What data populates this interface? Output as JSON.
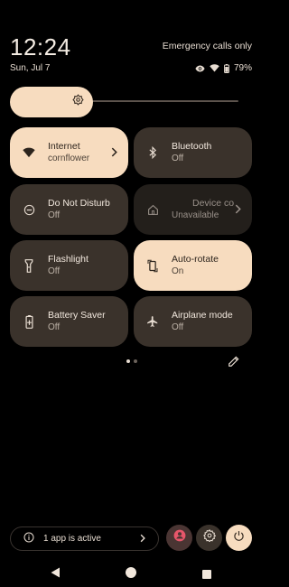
{
  "status": {
    "time": "12:24",
    "date": "Sun, Jul 7",
    "carrier": "Emergency calls only",
    "battery": "79%",
    "icons": [
      "eye-icon",
      "wifi-icon",
      "battery-icon"
    ]
  },
  "brightness": {
    "level": 0.3,
    "icon": "brightness-icon"
  },
  "tiles": [
    {
      "label": "Internet",
      "sub": "cornflower",
      "active": true,
      "icon": "wifi-icon"
    },
    {
      "label": "Bluetooth",
      "sub": "Off",
      "active": false,
      "icon": "bluetooth-icon"
    },
    {
      "label": "Do Not Disturb",
      "sub": "Off",
      "active": false,
      "icon": "dnd-icon"
    },
    {
      "label": "Device co",
      "sub": "Unavailable",
      "active": false,
      "icon": "home-icon"
    },
    {
      "label": "Flashlight",
      "sub": "Off",
      "active": false,
      "icon": "flashlight-icon"
    },
    {
      "label": "Auto-rotate",
      "sub": "On",
      "active": true,
      "icon": "rotate-icon"
    },
    {
      "label": "Battery Saver",
      "sub": "Off",
      "active": false,
      "icon": "battery-saver-icon"
    },
    {
      "label": "Airplane mode",
      "sub": "Off",
      "active": false,
      "icon": "airplane-icon"
    }
  ],
  "footer": {
    "active_apps": "1 app is active"
  },
  "colors": {
    "accent": "#f7dcbf",
    "tile": "#3a322b",
    "background": "#000000"
  }
}
